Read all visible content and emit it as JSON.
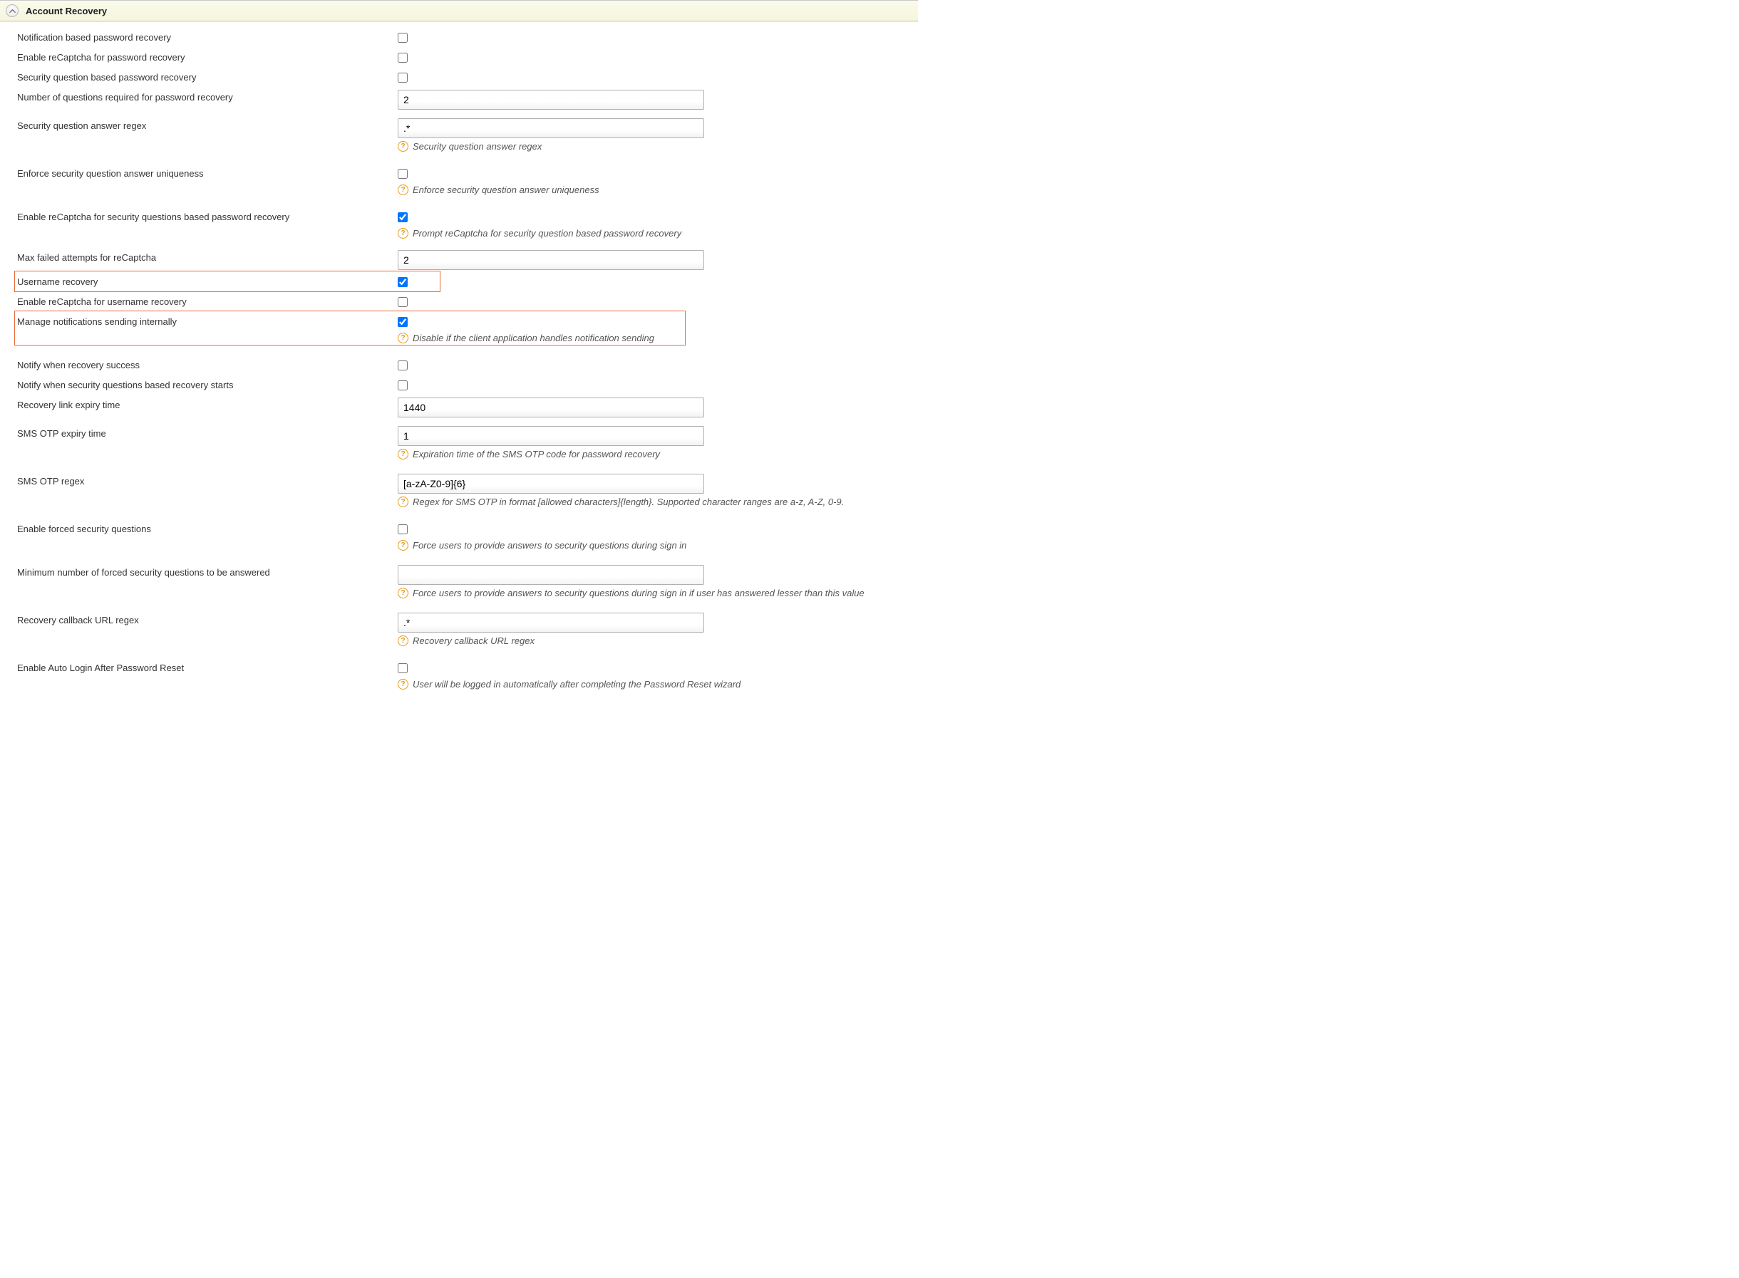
{
  "section": {
    "title": "Account Recovery"
  },
  "fields": {
    "notif_pw_recovery": {
      "label": "Notification based password recovery",
      "checked": false
    },
    "recaptcha_pw_recovery": {
      "label": "Enable reCaptcha for password recovery",
      "checked": false
    },
    "secq_pw_recovery": {
      "label": "Security question based password recovery",
      "checked": false
    },
    "num_questions": {
      "label": "Number of questions required for password recovery",
      "value": "2"
    },
    "secq_regex": {
      "label": "Security question answer regex",
      "value": ".*",
      "hint": "Security question answer regex"
    },
    "enforce_uniq": {
      "label": "Enforce security question answer uniqueness",
      "checked": false,
      "hint": "Enforce security question answer uniqueness"
    },
    "recaptcha_secq": {
      "label": "Enable reCaptcha for security questions based password recovery",
      "checked": true,
      "hint": "Prompt reCaptcha for security question based password recovery"
    },
    "max_failed_recaptcha": {
      "label": "Max failed attempts for reCaptcha",
      "value": "2"
    },
    "username_recovery": {
      "label": "Username recovery",
      "checked": true
    },
    "recaptcha_username": {
      "label": "Enable reCaptcha for username recovery",
      "checked": false
    },
    "manage_notif": {
      "label": "Manage notifications sending internally",
      "checked": true,
      "hint": "Disable if the client application handles notification sending"
    },
    "notify_success": {
      "label": "Notify when recovery success",
      "checked": false
    },
    "notify_secq_start": {
      "label": "Notify when security questions based recovery starts",
      "checked": false
    },
    "recovery_link_expiry": {
      "label": "Recovery link expiry time",
      "value": "1440"
    },
    "sms_otp_expiry": {
      "label": "SMS OTP expiry time",
      "value": "1",
      "hint": "Expiration time of the SMS OTP code for password recovery"
    },
    "sms_otp_regex": {
      "label": "SMS OTP regex",
      "value": "[a-zA-Z0-9]{6}",
      "hint": "Regex for SMS OTP in format [allowed characters]{length}. Supported character ranges are a-z, A-Z, 0-9."
    },
    "forced_secq": {
      "label": "Enable forced security questions",
      "checked": false,
      "hint": "Force users to provide answers to security questions during sign in"
    },
    "min_forced_secq": {
      "label": "Minimum number of forced security questions to be answered",
      "value": "",
      "hint": "Force users to provide answers to security questions during sign in if user has answered lesser than this value"
    },
    "callback_regex": {
      "label": "Recovery callback URL regex",
      "value": ".*",
      "hint": "Recovery callback URL regex"
    },
    "auto_login": {
      "label": "Enable Auto Login After Password Reset",
      "checked": false,
      "hint": "User will be logged in automatically after completing the Password Reset wizard"
    }
  }
}
